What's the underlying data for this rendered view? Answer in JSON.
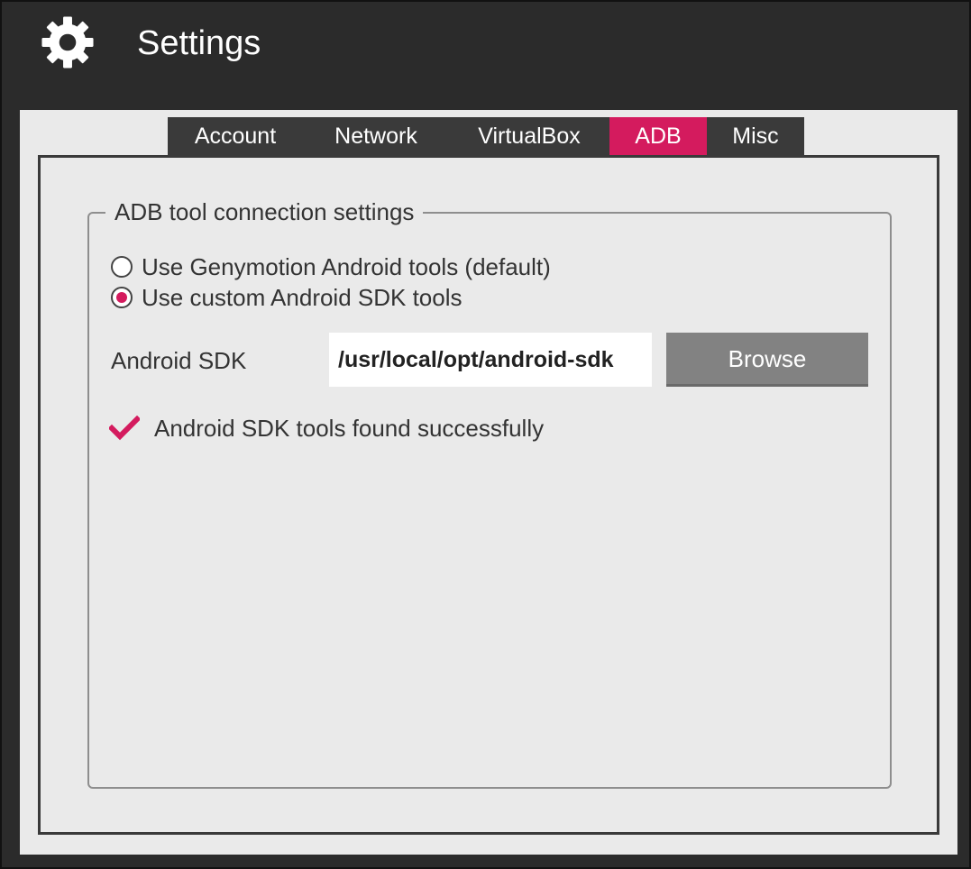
{
  "header": {
    "title": "Settings",
    "icon": "gear-icon"
  },
  "tabs": [
    {
      "label": "Account",
      "active": false
    },
    {
      "label": "Network",
      "active": false
    },
    {
      "label": "VirtualBox",
      "active": false
    },
    {
      "label": "ADB",
      "active": true
    },
    {
      "label": "Misc",
      "active": false
    }
  ],
  "adb": {
    "group_title": "ADB tool connection settings",
    "options": [
      {
        "label": "Use Genymotion Android tools (default)",
        "selected": false
      },
      {
        "label": "Use custom Android SDK tools",
        "selected": true
      }
    ],
    "sdk_label": "Android SDK",
    "sdk_path": "/usr/local/opt/android-sdk",
    "browse_label": "Browse",
    "status_icon": "check-icon",
    "status_text": "Android SDK tools found successfully"
  },
  "colors": {
    "accent": "#d41b5e",
    "titlebar": "#2b2b2b",
    "panel": "#eaeaea",
    "button": "#828282"
  }
}
